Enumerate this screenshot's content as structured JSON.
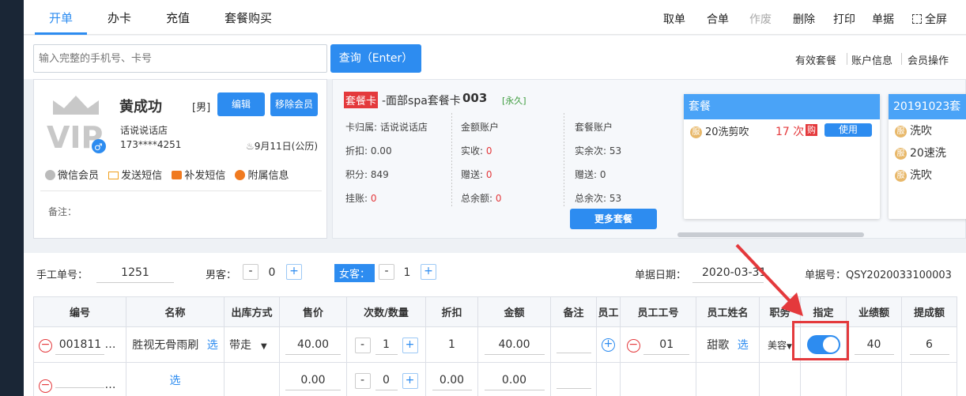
{
  "tabs": [
    "开单",
    "办卡",
    "充值",
    "套餐购买"
  ],
  "actions": [
    "取单",
    "合单",
    "作废",
    "删除",
    "打印",
    "单据",
    "全屏"
  ],
  "search": {
    "placeholder": "输入完整的手机号、卡号",
    "button": "查询（Enter）"
  },
  "links": [
    "有效套餐",
    "账户信息",
    "会员操作"
  ],
  "member": {
    "name": "黄成功",
    "gender": "[男]",
    "edit": "编辑",
    "remove": "移除会员",
    "store": "话说说话店",
    "phone": "173****4251",
    "birthday": "9月11日(公历)",
    "ops": [
      "微信会员",
      "发送短信",
      "补发短信",
      "附属信息"
    ],
    "note": "备注："
  },
  "card": {
    "tag": "套餐卡",
    "name": "-面部spa套餐卡",
    "no": "003",
    "perm": "[永久]",
    "c1": [
      "卡归属: 话说说话店",
      "折扣: 0.00",
      "积分: 849",
      "挂账: "
    ],
    "guazhang": "0",
    "c2_title": "金额账户",
    "c2": [
      "实收: ",
      "赠送: ",
      "总余额: "
    ],
    "c2v": [
      "0",
      "0",
      "0"
    ],
    "c3_title": "套餐账户",
    "c3": [
      "实余次: 53",
      "赠送: 0",
      "总余次: 53"
    ],
    "more": "更多套餐"
  },
  "pkg1": {
    "head": "套餐",
    "item": "20洗剪吹",
    "count": "17 次",
    "buy": "购",
    "use": "使用"
  },
  "pkg2": {
    "head": "20191023套",
    "items": [
      "洗吹",
      "20速洗",
      "洗吹"
    ]
  },
  "badge": "服",
  "form": {
    "manual_label": "手工单号：",
    "manual_value": "1251",
    "male_label": "男客：",
    "male_value": "0",
    "female_label": "女客：",
    "female_value": "1",
    "date_label": "单据日期：",
    "date_value": "2020-03-31",
    "bill_label": "单据号：QSY2020033100003"
  },
  "headers": [
    "编号",
    "名称",
    "出库方式",
    "售价",
    "次数/数量",
    "折扣",
    "金额",
    "备注",
    "员工",
    "员工工号",
    "员工姓名",
    "职务",
    "指定",
    "业绩额",
    "提成额"
  ],
  "rows": [
    {
      "code": "001811",
      "dots": "…",
      "name": "胜视无骨雨刷",
      "sel": "选",
      "out": "带走",
      "price": "40.00",
      "qty": "1",
      "disc": "1",
      "amt": "40.00",
      "empno": "01",
      "empname": "甜歌",
      "empsel": "选",
      "job": "美容",
      "perf": "40",
      "comm": "6"
    },
    {
      "code": "",
      "dots": "…",
      "name": "",
      "sel": "选",
      "out": "",
      "price": "0.00",
      "qty": "0",
      "disc": "0.00",
      "amt": "0.00",
      "empno": "",
      "empname": "",
      "empsel": "",
      "job": "",
      "perf": "",
      "comm": ""
    }
  ]
}
